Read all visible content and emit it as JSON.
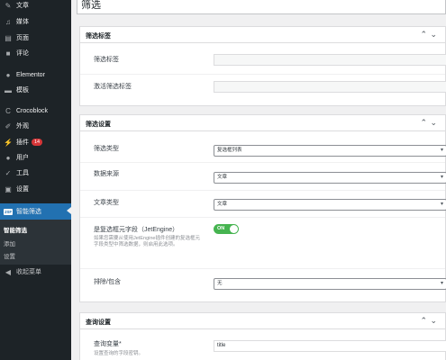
{
  "sidebar": {
    "items": [
      {
        "label": "文章",
        "icon": "pin-icon"
      },
      {
        "label": "媒体",
        "icon": "media-icon"
      },
      {
        "label": "页面",
        "icon": "page-icon"
      },
      {
        "label": "评论",
        "icon": "comment-icon"
      },
      {
        "label": "Elementor",
        "icon": "elementor-icon"
      },
      {
        "label": "模板",
        "icon": "folder-icon"
      },
      {
        "label": "Crocoblock",
        "icon": "crocoblock-icon"
      },
      {
        "label": "外观",
        "icon": "brush-icon"
      },
      {
        "label": "插件",
        "icon": "plugin-icon",
        "badge": "14"
      },
      {
        "label": "用户",
        "icon": "user-icon"
      },
      {
        "label": "工具",
        "icon": "wrench-icon"
      },
      {
        "label": "设置",
        "icon": "settings-icon"
      },
      {
        "label": "智能筛选",
        "icon": "jet-icon",
        "active": true
      },
      {
        "label": "收起菜单",
        "icon": "collapse-icon"
      }
    ],
    "jet_icon_text": "JSF",
    "submenu": [
      {
        "label": "智能筛选",
        "current": true
      },
      {
        "label": "添加"
      },
      {
        "label": "设置"
      }
    ]
  },
  "page": {
    "title": "筛选"
  },
  "panels": {
    "labels": {
      "title": "筛选标签",
      "filter_label": "筛选标签",
      "filter_label_value": "",
      "active_label": "激活筛选标签",
      "active_label_value": ""
    },
    "settings": {
      "title": "筛选设置",
      "filter_type_label": "筛选类型",
      "filter_type_value": "复选框列表",
      "data_source_label": "数据来源",
      "data_source_value": "文章",
      "post_type_label": "文章类型",
      "post_type_value": "文章",
      "is_checkbox_meta_label": "是复选框元字段（JetEngine）",
      "is_checkbox_meta_desc": "如果您需要从使用JetEngine插件创建的复选框元字段类型中筛选数据，则启用此选项。",
      "is_checkbox_meta_toggle": "ON",
      "exclude_include_label": "排除/包含",
      "exclude_include_value": "无"
    },
    "query": {
      "title": "查询设置",
      "query_var_label": "查询变量*",
      "query_var_desc": "设置查询的字段密钥。",
      "query_var_value": "title"
    }
  },
  "colors": {
    "sidebar_bg": "#1d2327",
    "active_bg": "#2271b1",
    "toggle_on": "#46b450",
    "badge": "#d63638"
  }
}
